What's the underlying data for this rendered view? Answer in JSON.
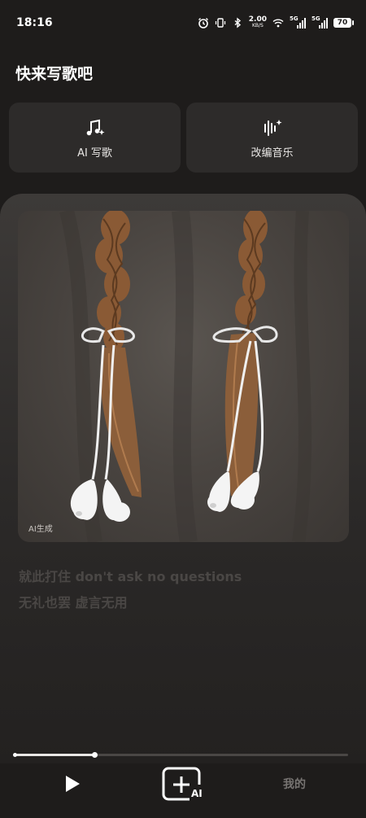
{
  "status_bar": {
    "time": "18:16",
    "net_speed_value": "2.00",
    "net_speed_unit": "KB/S",
    "signal1_label": "5G",
    "signal2_label": "5G",
    "battery": "70",
    "icons": [
      "alarm-icon",
      "vibrate-icon",
      "bluetooth-icon",
      "wifi-icon",
      "signal-icon",
      "battery-icon"
    ]
  },
  "header": {
    "title": "快来写歌吧"
  },
  "features": [
    {
      "label": "AI 写歌",
      "icon": "music-note-sparkle-icon"
    },
    {
      "label": "改编音乐",
      "icon": "waveform-sparkle-icon"
    }
  ],
  "cover": {
    "ai_tag": "AI生成",
    "image_desc_icon": "braids-earphones-image"
  },
  "lyrics": {
    "line1": "就此打住 don't ask no questions",
    "line2": "无礼也罢 虚言无用"
  },
  "player": {
    "progress": 0.24
  },
  "nav": {
    "play_icon": "play-icon",
    "create_icon": "add-ai-icon",
    "create_badge": "AI",
    "mine_label": "我的"
  },
  "colors": {
    "background": "#1e1c1b",
    "card": "#2d2b2a",
    "muted_text": "#4a4745"
  }
}
